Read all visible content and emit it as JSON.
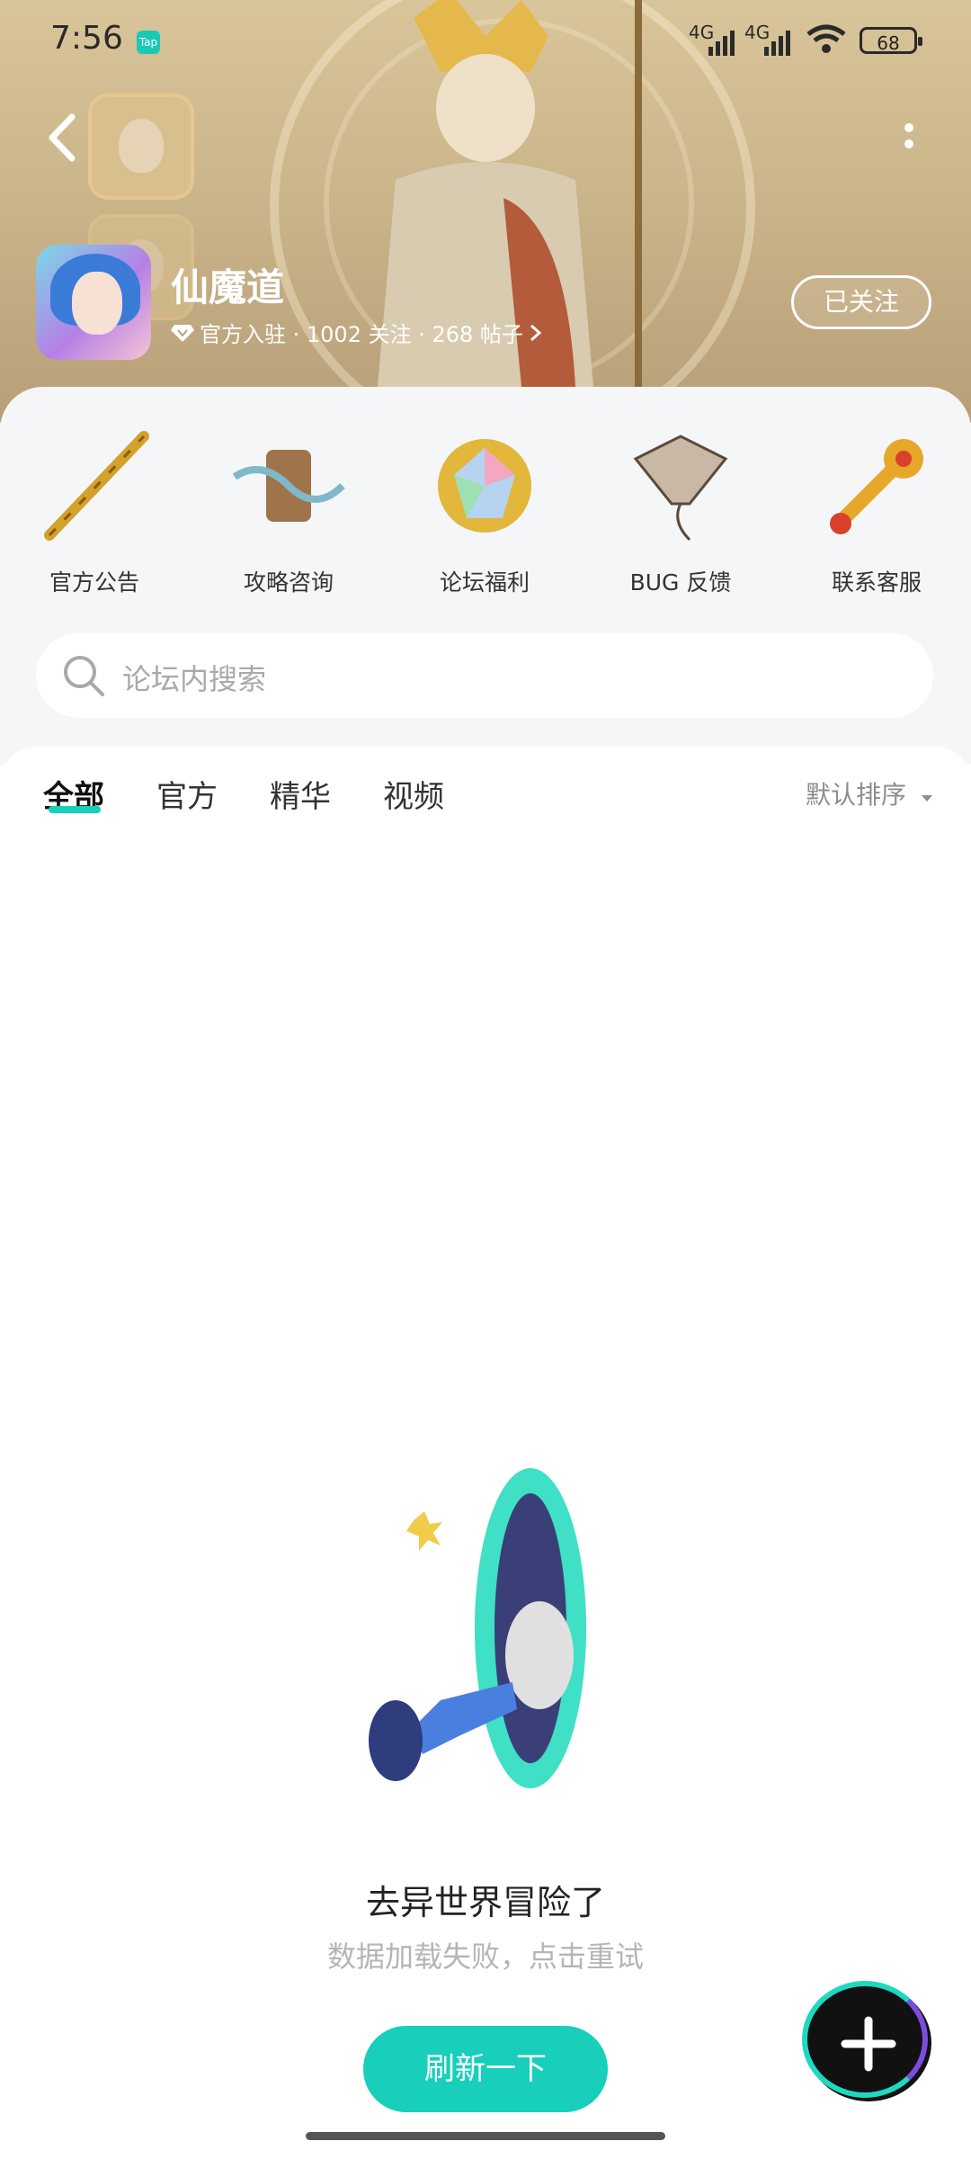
{
  "status_bar": {
    "time": "7:56",
    "app_badge": "Tap",
    "network_1": "4G",
    "network_2": "4G",
    "battery": "68"
  },
  "header": {
    "app_name": "仙魔道",
    "meta": "官方入驻 · 1002 关注 · 268 帖子",
    "follow_label": "已关注"
  },
  "quick_links": [
    {
      "label": "官方公告",
      "icon": "staff-icon"
    },
    {
      "label": "攻略咨询",
      "icon": "scroll-icon"
    },
    {
      "label": "论坛福利",
      "icon": "gem-icon"
    },
    {
      "label": "BUG 反馈",
      "icon": "kite-icon"
    },
    {
      "label": "联系客服",
      "icon": "ruyi-icon"
    }
  ],
  "search": {
    "placeholder": "论坛内搜索"
  },
  "tabs": [
    {
      "label": "全部",
      "active": true
    },
    {
      "label": "官方",
      "active": false
    },
    {
      "label": "精华",
      "active": false
    },
    {
      "label": "视频",
      "active": false
    }
  ],
  "sort": {
    "label": "默认排序"
  },
  "empty": {
    "title": "去异世界冒险了",
    "subtitle": "数据加载失败，点击重试",
    "button": "刷新一下"
  },
  "colors": {
    "accent": "#17cfbb",
    "header_bg": "#cbb58a"
  }
}
